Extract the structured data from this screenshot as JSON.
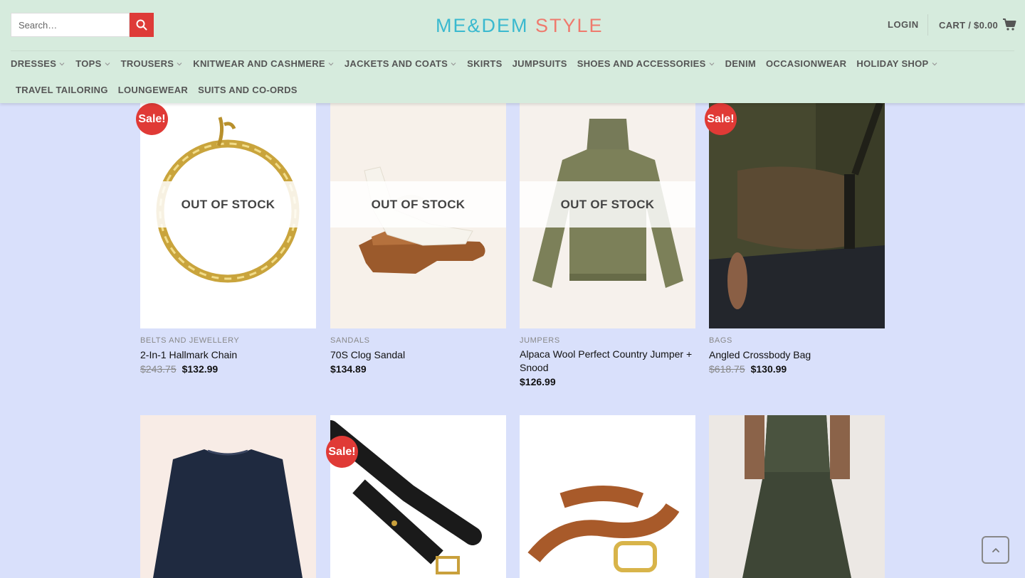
{
  "header": {
    "search_placeholder": "Search…",
    "logo_part1": "ME&DEM",
    "logo_part2": "STYLE",
    "login": "LOGIN",
    "cart_label": "CART / $0.00"
  },
  "nav": {
    "row1": [
      {
        "label": "DRESSES",
        "dropdown": true
      },
      {
        "label": "TOPS",
        "dropdown": true
      },
      {
        "label": "TROUSERS",
        "dropdown": true
      },
      {
        "label": "KNITWEAR AND CASHMERE",
        "dropdown": true
      },
      {
        "label": "JACKETS AND COATS",
        "dropdown": true
      },
      {
        "label": "SKIRTS",
        "dropdown": false
      },
      {
        "label": "JUMPSUITS",
        "dropdown": false
      },
      {
        "label": "SHOES AND ACCESSORIES",
        "dropdown": true
      },
      {
        "label": "DENIM",
        "dropdown": false
      },
      {
        "label": "OCCASIONWEAR",
        "dropdown": false
      },
      {
        "label": "HOLIDAY SHOP",
        "dropdown": true
      }
    ],
    "row2": [
      {
        "label": "TRAVEL TAILORING",
        "dropdown": false
      },
      {
        "label": "LOUNGEWEAR",
        "dropdown": false
      },
      {
        "label": "SUITS AND CO-ORDS",
        "dropdown": false
      }
    ]
  },
  "badges": {
    "sale": "Sale!",
    "out_of_stock": "OUT OF STOCK"
  },
  "products": [
    {
      "category": "BELTS AND JEWELLERY",
      "name": "2-In-1 Hallmark Chain",
      "old_price": "$243.75",
      "price": "$132.99",
      "sale": true,
      "out_of_stock": true
    },
    {
      "category": "SANDALS",
      "name": "70S Clog Sandal",
      "old_price": "",
      "price": "$134.89",
      "sale": false,
      "out_of_stock": true
    },
    {
      "category": "JUMPERS",
      "name": "Alpaca Wool Perfect Country Jumper + Snood",
      "old_price": "",
      "price": "$126.99",
      "sale": false,
      "out_of_stock": true
    },
    {
      "category": "BAGS",
      "name": "Angled Crossbody Bag",
      "old_price": "$618.75",
      "price": "$130.99",
      "sale": true,
      "out_of_stock": false
    }
  ],
  "second_row_sale": "Sale!"
}
